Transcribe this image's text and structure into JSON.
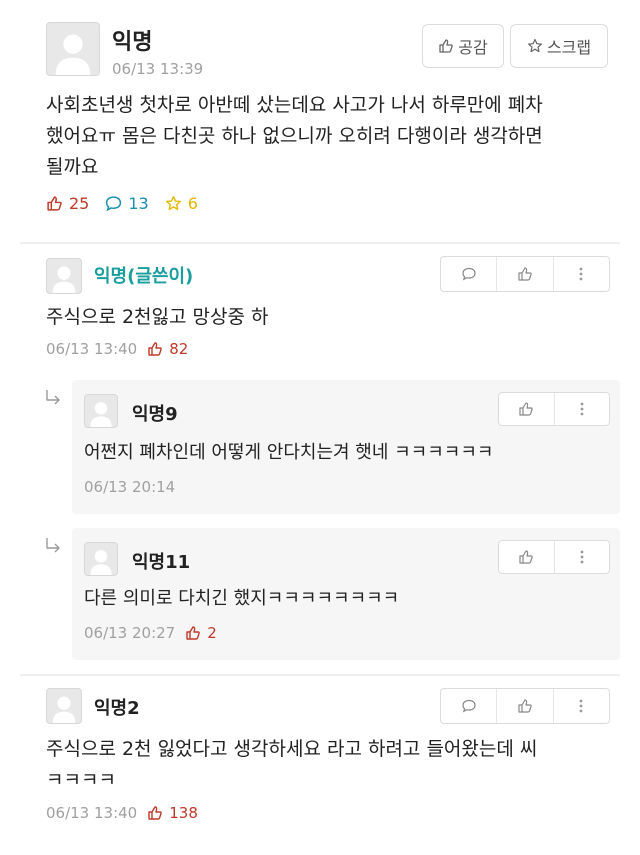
{
  "post": {
    "author": "익명",
    "time": "06/13 13:39",
    "buttons": {
      "like": "공감",
      "scrap": "스크랩"
    },
    "body_line1": "사회초년생 첫차로 아반떼 샀는데요 사고가 나서 하루만에 폐차",
    "body_line2": "했어요ㅠ 몸은 다친곳 하나 없으니까 오히려 다행이라 생각하면",
    "body_line3": "될까요",
    "counts": {
      "likes": "25",
      "comments": "13",
      "scraps": "6"
    }
  },
  "comments": [
    {
      "author": "익명(글쓴이)",
      "text": "주식으로 2천잃고 망상중 하",
      "time": "06/13 13:40",
      "likes": "82"
    },
    {
      "author": "익명2",
      "text_line1": "주식으로 2천 잃었다고 생각하세요 라고 하려고 들어왔는데 씨",
      "text_line2": "ㅋㅋㅋㅋ",
      "time": "06/13 13:40",
      "likes": "138"
    }
  ],
  "replies": [
    {
      "author": "익명9",
      "text": "어쩐지 폐차인데 어떻게 안다치는겨 햇네 ㅋㅋㅋㅋㅋㅋ",
      "time": "06/13 20:14"
    },
    {
      "author": "익명11",
      "text": "다른 의미로 다치긴 했지ㅋㅋㅋㅋㅋㅋㅋㅋ",
      "time": "06/13 20:27",
      "likes": "2"
    }
  ],
  "colors": {
    "like_red": "#c0392b",
    "comment_blue": "#1a8fb0",
    "scrap_yellow": "#e6b800",
    "op_teal": "#1a9e9e"
  }
}
